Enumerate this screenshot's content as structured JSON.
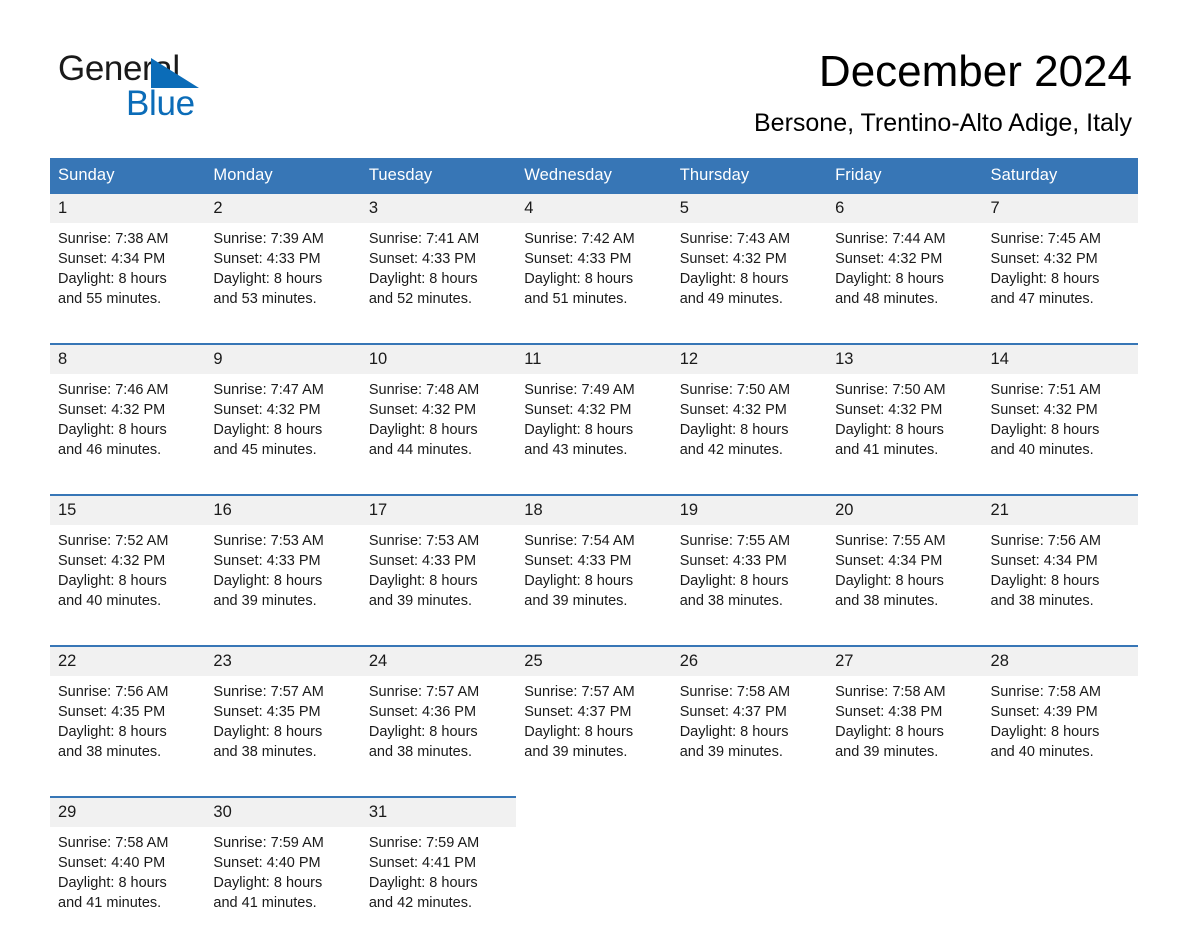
{
  "brand": {
    "name_part1": "General",
    "name_part2": "Blue",
    "accent_color": "#0b6cb8",
    "triangle_icon": "triangle-icon"
  },
  "header": {
    "month_title": "December 2024",
    "location": "Bersone, Trentino-Alto Adige, Italy"
  },
  "calendar": {
    "header_bg_color": "#3776b6",
    "daynum_bg_color": "#f1f1f1",
    "weekdays": [
      "Sunday",
      "Monday",
      "Tuesday",
      "Wednesday",
      "Thursday",
      "Friday",
      "Saturday"
    ],
    "weeks": [
      {
        "days": [
          {
            "num": "1",
            "sunrise": "Sunrise: 7:38 AM",
            "sunset": "Sunset: 4:34 PM",
            "daylight1": "Daylight: 8 hours",
            "daylight2": "and 55 minutes."
          },
          {
            "num": "2",
            "sunrise": "Sunrise: 7:39 AM",
            "sunset": "Sunset: 4:33 PM",
            "daylight1": "Daylight: 8 hours",
            "daylight2": "and 53 minutes."
          },
          {
            "num": "3",
            "sunrise": "Sunrise: 7:41 AM",
            "sunset": "Sunset: 4:33 PM",
            "daylight1": "Daylight: 8 hours",
            "daylight2": "and 52 minutes."
          },
          {
            "num": "4",
            "sunrise": "Sunrise: 7:42 AM",
            "sunset": "Sunset: 4:33 PM",
            "daylight1": "Daylight: 8 hours",
            "daylight2": "and 51 minutes."
          },
          {
            "num": "5",
            "sunrise": "Sunrise: 7:43 AM",
            "sunset": "Sunset: 4:32 PM",
            "daylight1": "Daylight: 8 hours",
            "daylight2": "and 49 minutes."
          },
          {
            "num": "6",
            "sunrise": "Sunrise: 7:44 AM",
            "sunset": "Sunset: 4:32 PM",
            "daylight1": "Daylight: 8 hours",
            "daylight2": "and 48 minutes."
          },
          {
            "num": "7",
            "sunrise": "Sunrise: 7:45 AM",
            "sunset": "Sunset: 4:32 PM",
            "daylight1": "Daylight: 8 hours",
            "daylight2": "and 47 minutes."
          }
        ]
      },
      {
        "days": [
          {
            "num": "8",
            "sunrise": "Sunrise: 7:46 AM",
            "sunset": "Sunset: 4:32 PM",
            "daylight1": "Daylight: 8 hours",
            "daylight2": "and 46 minutes."
          },
          {
            "num": "9",
            "sunrise": "Sunrise: 7:47 AM",
            "sunset": "Sunset: 4:32 PM",
            "daylight1": "Daylight: 8 hours",
            "daylight2": "and 45 minutes."
          },
          {
            "num": "10",
            "sunrise": "Sunrise: 7:48 AM",
            "sunset": "Sunset: 4:32 PM",
            "daylight1": "Daylight: 8 hours",
            "daylight2": "and 44 minutes."
          },
          {
            "num": "11",
            "sunrise": "Sunrise: 7:49 AM",
            "sunset": "Sunset: 4:32 PM",
            "daylight1": "Daylight: 8 hours",
            "daylight2": "and 43 minutes."
          },
          {
            "num": "12",
            "sunrise": "Sunrise: 7:50 AM",
            "sunset": "Sunset: 4:32 PM",
            "daylight1": "Daylight: 8 hours",
            "daylight2": "and 42 minutes."
          },
          {
            "num": "13",
            "sunrise": "Sunrise: 7:50 AM",
            "sunset": "Sunset: 4:32 PM",
            "daylight1": "Daylight: 8 hours",
            "daylight2": "and 41 minutes."
          },
          {
            "num": "14",
            "sunrise": "Sunrise: 7:51 AM",
            "sunset": "Sunset: 4:32 PM",
            "daylight1": "Daylight: 8 hours",
            "daylight2": "and 40 minutes."
          }
        ]
      },
      {
        "days": [
          {
            "num": "15",
            "sunrise": "Sunrise: 7:52 AM",
            "sunset": "Sunset: 4:32 PM",
            "daylight1": "Daylight: 8 hours",
            "daylight2": "and 40 minutes."
          },
          {
            "num": "16",
            "sunrise": "Sunrise: 7:53 AM",
            "sunset": "Sunset: 4:33 PM",
            "daylight1": "Daylight: 8 hours",
            "daylight2": "and 39 minutes."
          },
          {
            "num": "17",
            "sunrise": "Sunrise: 7:53 AM",
            "sunset": "Sunset: 4:33 PM",
            "daylight1": "Daylight: 8 hours",
            "daylight2": "and 39 minutes."
          },
          {
            "num": "18",
            "sunrise": "Sunrise: 7:54 AM",
            "sunset": "Sunset: 4:33 PM",
            "daylight1": "Daylight: 8 hours",
            "daylight2": "and 39 minutes."
          },
          {
            "num": "19",
            "sunrise": "Sunrise: 7:55 AM",
            "sunset": "Sunset: 4:33 PM",
            "daylight1": "Daylight: 8 hours",
            "daylight2": "and 38 minutes."
          },
          {
            "num": "20",
            "sunrise": "Sunrise: 7:55 AM",
            "sunset": "Sunset: 4:34 PM",
            "daylight1": "Daylight: 8 hours",
            "daylight2": "and 38 minutes."
          },
          {
            "num": "21",
            "sunrise": "Sunrise: 7:56 AM",
            "sunset": "Sunset: 4:34 PM",
            "daylight1": "Daylight: 8 hours",
            "daylight2": "and 38 minutes."
          }
        ]
      },
      {
        "days": [
          {
            "num": "22",
            "sunrise": "Sunrise: 7:56 AM",
            "sunset": "Sunset: 4:35 PM",
            "daylight1": "Daylight: 8 hours",
            "daylight2": "and 38 minutes."
          },
          {
            "num": "23",
            "sunrise": "Sunrise: 7:57 AM",
            "sunset": "Sunset: 4:35 PM",
            "daylight1": "Daylight: 8 hours",
            "daylight2": "and 38 minutes."
          },
          {
            "num": "24",
            "sunrise": "Sunrise: 7:57 AM",
            "sunset": "Sunset: 4:36 PM",
            "daylight1": "Daylight: 8 hours",
            "daylight2": "and 38 minutes."
          },
          {
            "num": "25",
            "sunrise": "Sunrise: 7:57 AM",
            "sunset": "Sunset: 4:37 PM",
            "daylight1": "Daylight: 8 hours",
            "daylight2": "and 39 minutes."
          },
          {
            "num": "26",
            "sunrise": "Sunrise: 7:58 AM",
            "sunset": "Sunset: 4:37 PM",
            "daylight1": "Daylight: 8 hours",
            "daylight2": "and 39 minutes."
          },
          {
            "num": "27",
            "sunrise": "Sunrise: 7:58 AM",
            "sunset": "Sunset: 4:38 PM",
            "daylight1": "Daylight: 8 hours",
            "daylight2": "and 39 minutes."
          },
          {
            "num": "28",
            "sunrise": "Sunrise: 7:58 AM",
            "sunset": "Sunset: 4:39 PM",
            "daylight1": "Daylight: 8 hours",
            "daylight2": "and 40 minutes."
          }
        ]
      },
      {
        "days": [
          {
            "num": "29",
            "sunrise": "Sunrise: 7:58 AM",
            "sunset": "Sunset: 4:40 PM",
            "daylight1": "Daylight: 8 hours",
            "daylight2": "and 41 minutes."
          },
          {
            "num": "30",
            "sunrise": "Sunrise: 7:59 AM",
            "sunset": "Sunset: 4:40 PM",
            "daylight1": "Daylight: 8 hours",
            "daylight2": "and 41 minutes."
          },
          {
            "num": "31",
            "sunrise": "Sunrise: 7:59 AM",
            "sunset": "Sunset: 4:41 PM",
            "daylight1": "Daylight: 8 hours",
            "daylight2": "and 42 minutes."
          },
          {
            "num": "",
            "sunrise": "",
            "sunset": "",
            "daylight1": "",
            "daylight2": ""
          },
          {
            "num": "",
            "sunrise": "",
            "sunset": "",
            "daylight1": "",
            "daylight2": ""
          },
          {
            "num": "",
            "sunrise": "",
            "sunset": "",
            "daylight1": "",
            "daylight2": ""
          },
          {
            "num": "",
            "sunrise": "",
            "sunset": "",
            "daylight1": "",
            "daylight2": ""
          }
        ]
      }
    ]
  }
}
